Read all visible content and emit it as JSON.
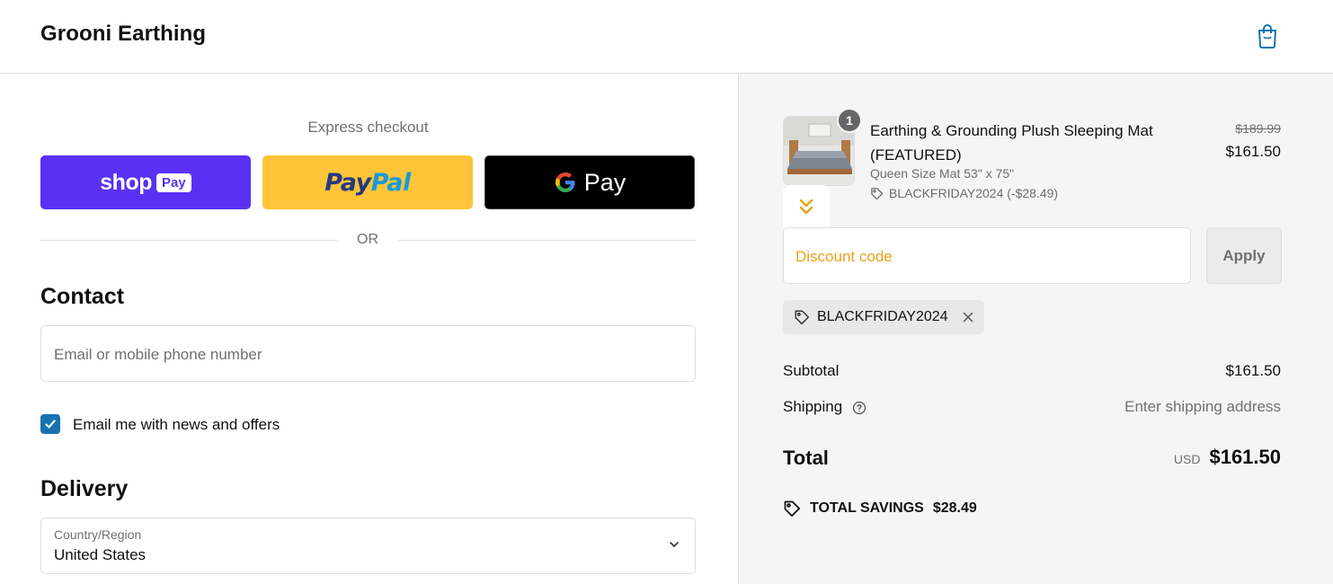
{
  "header": {
    "store_name": "Grooni Earthing",
    "cart_icon": "shopping-bag-icon"
  },
  "express": {
    "title": "Express checkout",
    "shop_pay": {
      "word": "shop",
      "pill": "Pay",
      "color": "#5a31f4"
    },
    "paypal": {
      "part1": "Pay",
      "part2": "Pal",
      "color": "#ffc439"
    },
    "gpay": {
      "label": "Pay"
    },
    "or_label": "OR"
  },
  "contact": {
    "heading": "Contact",
    "email_placeholder": "Email or mobile phone number",
    "newsletter_label": "Email me with news and offers",
    "newsletter_checked": true
  },
  "delivery": {
    "heading": "Delivery",
    "country_label": "Country/Region",
    "country_value": "United States"
  },
  "order": {
    "quantity": "1",
    "product_name": "Earthing & Grounding Plush Sleeping Mat (FEATURED)",
    "variant": "Queen Size Mat 53\" x 75\"",
    "discount_line": "BLACKFRIDAY2024 (-$28.49)",
    "original_price": "$189.99",
    "price": "$161.50"
  },
  "discount": {
    "placeholder": "Discount code",
    "apply_label": "Apply",
    "applied_code": "BLACKFRIDAY2024"
  },
  "totals": {
    "subtotal_label": "Subtotal",
    "subtotal_value": "$161.50",
    "shipping_label": "Shipping",
    "shipping_value": "Enter shipping address",
    "total_label": "Total",
    "currency": "USD",
    "total_value": "$161.50",
    "savings_label": "TOTAL SAVINGS",
    "savings_value": "$28.49"
  },
  "colors": {
    "accent": "#1773b0",
    "summary_bg": "#f5f5f5",
    "discount_placeholder": "#e8a317"
  }
}
